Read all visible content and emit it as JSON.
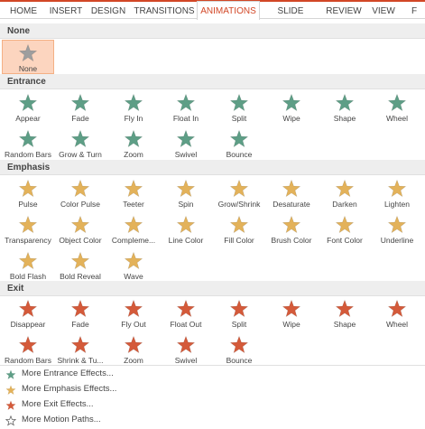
{
  "ribbon": {
    "tabs": [
      "HOME",
      "INSERT",
      "DESIGN",
      "TRANSITIONS",
      "ANIMATIONS",
      "SLIDE SHOW",
      "REVIEW",
      "VIEW",
      "F"
    ],
    "active": "ANIMATIONS"
  },
  "colors": {
    "accent": "#d24726",
    "none": "#9e9e9e",
    "entrance": "#5e9e86",
    "emphasis": "#e3b25a",
    "exit": "#d45a3a",
    "motion": "#555555"
  },
  "sections": {
    "none": "None",
    "entrance": "Entrance",
    "emphasis": "Emphasis",
    "exit": "Exit"
  },
  "none_effects": [
    "None"
  ],
  "entrance_effects": [
    "Appear",
    "Fade",
    "Fly In",
    "Float In",
    "Split",
    "Wipe",
    "Shape",
    "Wheel",
    "Random Bars",
    "Grow & Turn",
    "Zoom",
    "Swivel",
    "Bounce"
  ],
  "emphasis_effects": [
    "Pulse",
    "Color Pulse",
    "Teeter",
    "Spin",
    "Grow/Shrink",
    "Desaturate",
    "Darken",
    "Lighten",
    "Transparency",
    "Object Color",
    "Compleme...",
    "Line Color",
    "Fill Color",
    "Brush Color",
    "Font Color",
    "Underline",
    "Bold Flash",
    "Bold Reveal",
    "Wave"
  ],
  "exit_effects": [
    "Disappear",
    "Fade",
    "Fly Out",
    "Float Out",
    "Split",
    "Wipe",
    "Shape",
    "Wheel",
    "Random Bars",
    "Shrink & Tu...",
    "Zoom",
    "Swivel",
    "Bounce"
  ],
  "more_links": [
    {
      "label": "More Entrance Effects...",
      "icon": "entrance-star-icon"
    },
    {
      "label": "More Emphasis Effects...",
      "icon": "emphasis-star-icon"
    },
    {
      "label": "More Exit Effects...",
      "icon": "exit-star-icon"
    },
    {
      "label": "More Motion Paths...",
      "icon": "motion-path-star-icon"
    }
  ]
}
